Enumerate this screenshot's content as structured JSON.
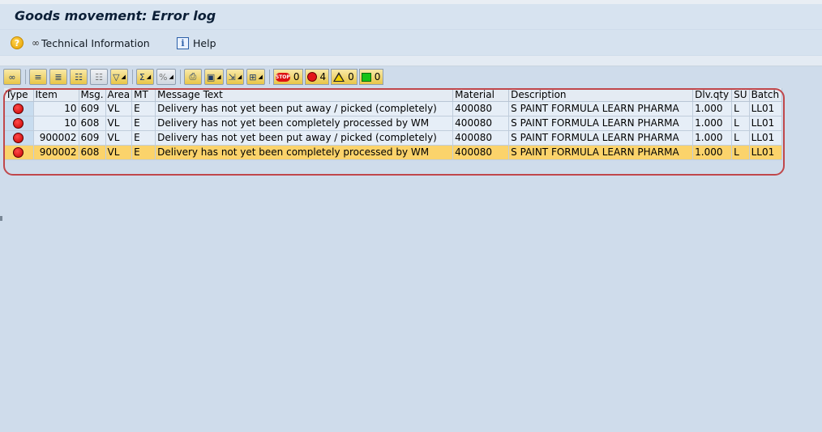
{
  "title": "Goods movement: Error log",
  "app_toolbar": {
    "technical_info_label": "Technical Information",
    "help_label": "Help"
  },
  "alv_toolbar": {
    "stop_count": "0",
    "error_count": "4",
    "warning_count": "0",
    "success_count": "0"
  },
  "table": {
    "columns": [
      "Type",
      "Item",
      "Msg.",
      "Area",
      "MT",
      "Message Text",
      "Material",
      "Description",
      "Dlv.qty",
      "SU",
      "Batch"
    ],
    "rows": [
      {
        "item": "10",
        "msg": "609",
        "area": "VL",
        "mt": "E",
        "text": "Delivery has not yet been put away / picked (completely)",
        "material": "400080",
        "description": "S PAINT FORMULA LEARN PHARMA",
        "qty": "1.000",
        "su": "L",
        "batch": "LL01"
      },
      {
        "item": "10",
        "msg": "608",
        "area": "VL",
        "mt": "E",
        "text": "Delivery has not yet been completely processed by WM",
        "material": "400080",
        "description": "S PAINT FORMULA LEARN PHARMA",
        "qty": "1.000",
        "su": "L",
        "batch": "LL01"
      },
      {
        "item": "900002",
        "msg": "609",
        "area": "VL",
        "mt": "E",
        "text": "Delivery has not yet been put away / picked (completely)",
        "material": "400080",
        "description": "S PAINT FORMULA LEARN PHARMA",
        "qty": "1.000",
        "su": "L",
        "batch": "LL01"
      },
      {
        "item": "900002",
        "msg": "608",
        "area": "VL",
        "mt": "E",
        "text": "Delivery has not yet been completely processed by WM",
        "material": "400080",
        "description": "S PAINT FORMULA LEARN PHARMA",
        "qty": "1.000",
        "su": "L",
        "batch": "LL01"
      }
    ]
  },
  "colors": {
    "selected_row": "#fbd36b",
    "error_icon": "#e3151a",
    "highlight_outline": "#c0474b"
  },
  "icons": {
    "type_status": "red-led-icon",
    "help": "question-circle-icon",
    "technical_info": "glasses-icon",
    "info": "info-box-icon"
  }
}
